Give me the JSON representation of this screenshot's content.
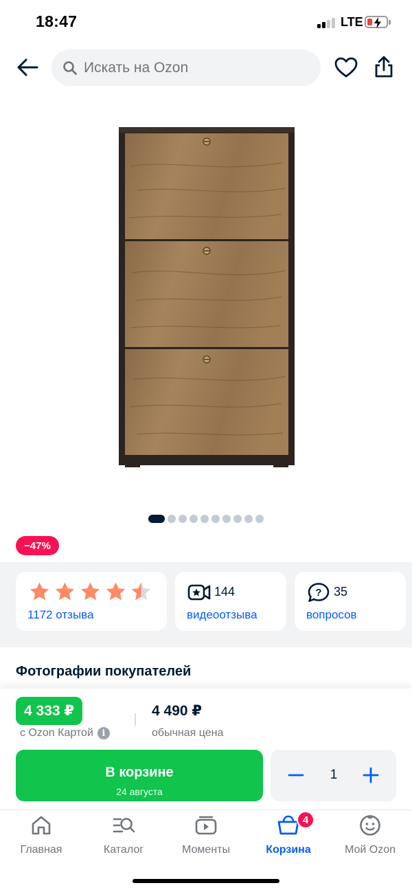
{
  "status_bar": {
    "time": "18:47",
    "network": "LTE"
  },
  "search": {
    "placeholder": "Искать на Ozon"
  },
  "product": {
    "discount": "−47%",
    "images_total": 10,
    "images_active_index": 0
  },
  "reviews": {
    "stars": 4.5,
    "count_label": "1172 отзыва"
  },
  "videos": {
    "count": "144",
    "label": "видеоотзыва"
  },
  "questions": {
    "count": "35",
    "label": "вопросов"
  },
  "section": {
    "customer_photos_title": "Фотографии покупателей"
  },
  "price": {
    "ozon_card_price": "4 333 ₽",
    "ozon_card_label": "с Ozon Картой",
    "info_glyph": "i",
    "regular_price": "4 490 ₽",
    "regular_label": "обычная цена"
  },
  "cart": {
    "button_label": "В корзине",
    "delivery_text": "24 августа"
  },
  "stepper": {
    "minus": "−",
    "quantity": "1",
    "plus": "+"
  },
  "tabs": [
    {
      "label": "Главная",
      "icon": "home-icon"
    },
    {
      "label": "Каталог",
      "icon": "catalog-icon"
    },
    {
      "label": "Моменты",
      "icon": "moments-icon"
    },
    {
      "label": "Корзина",
      "icon": "cart-icon",
      "badge": "4",
      "active": true
    },
    {
      "label": "Мой Ozon",
      "icon": "profile-icon"
    }
  ],
  "colors": {
    "accent_blue": "#005bff",
    "green": "#10c44c",
    "discount_pink": "#f91155",
    "star_orange": "#ff8a65",
    "text_dark": "#001a34"
  }
}
